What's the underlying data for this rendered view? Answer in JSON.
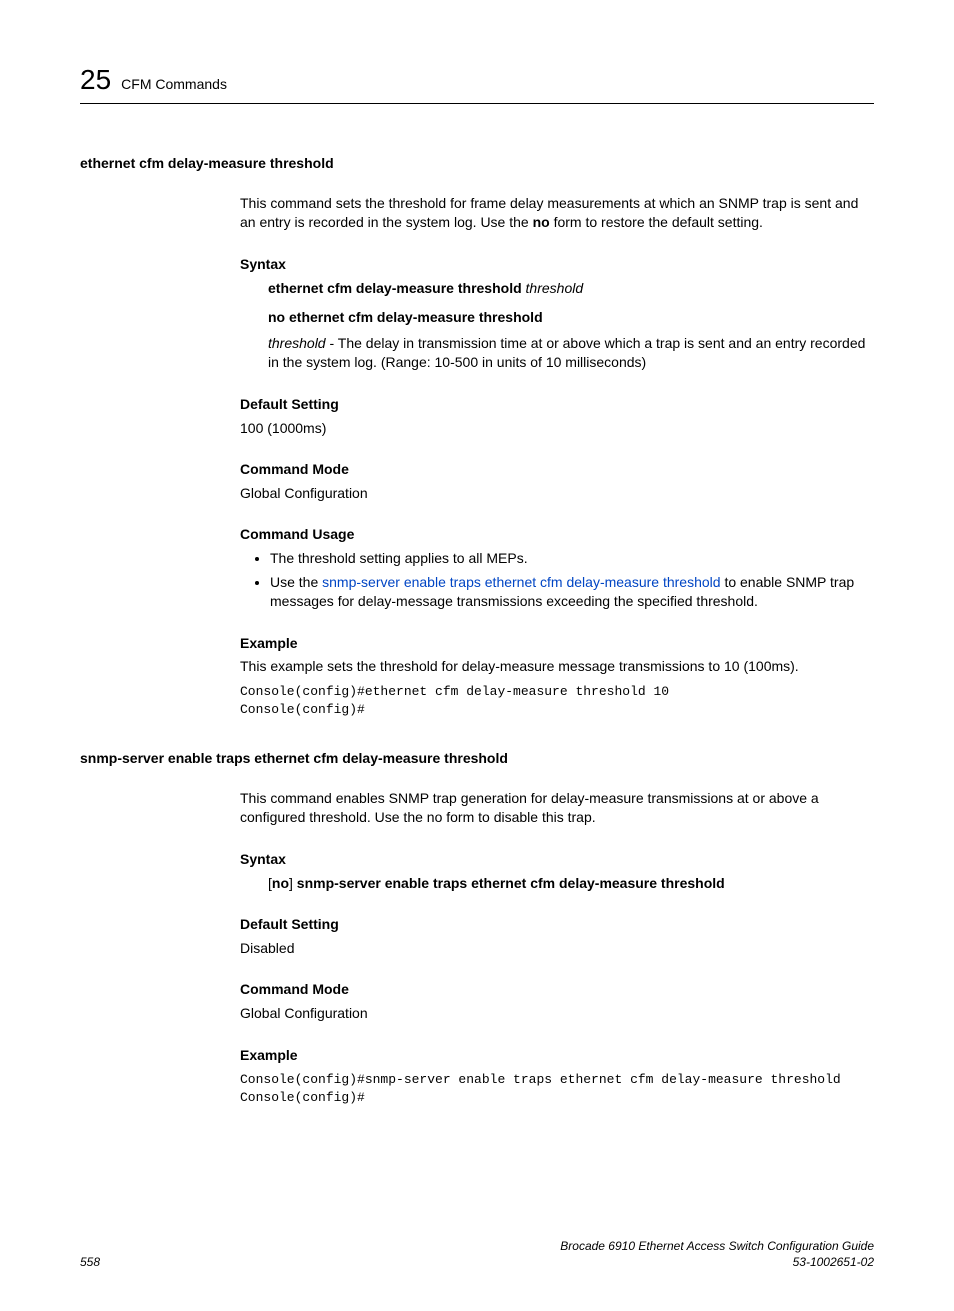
{
  "header": {
    "chapter_num": "25",
    "chapter_title": "CFM Commands"
  },
  "cmd1": {
    "heading": "ethernet cfm delay-measure threshold",
    "desc_pre": "This command sets the threshold for frame delay measurements at which an SNMP trap is sent and an entry is recorded in the system log. Use the ",
    "desc_bold": "no",
    "desc_post": " form to restore the default setting.",
    "syntax_label": "Syntax",
    "syntax_line1_bold": "ethernet cfm delay-measure threshold",
    "syntax_line1_italic": " threshold",
    "syntax_line2": "no ethernet cfm delay-measure threshold",
    "param_name": "threshold",
    "param_desc": " - The delay in transmission time at or above which a trap is sent and an entry recorded in the system log. (Range: 10-500 in units of 10 milliseconds)",
    "default_label": "Default Setting",
    "default_value": "100 (1000ms)",
    "mode_label": "Command Mode",
    "mode_value": "Global Configuration",
    "usage_label": "Command Usage",
    "usage_b1": "The threshold setting applies to all MEPs.",
    "usage_b2_pre": "Use the ",
    "usage_b2_link": "snmp-server enable traps ethernet cfm delay-measure threshold",
    "usage_b2_post": " to enable SNMP trap messages for delay-message transmissions exceeding the specified threshold.",
    "example_label": "Example",
    "example_desc": "This example sets the threshold for delay-measure message transmissions to 10 (100ms).",
    "example_code": "Console(config)#ethernet cfm delay-measure threshold 10\nConsole(config)#"
  },
  "cmd2": {
    "heading": "snmp-server enable traps ethernet cfm delay-measure threshold",
    "desc": "This command enables SNMP trap generation for delay-measure transmissions at or above a configured threshold. Use the no form to disable this trap.",
    "syntax_label": "Syntax",
    "syntax_pre": "[",
    "syntax_no": "no",
    "syntax_mid": "] ",
    "syntax_cmd": "snmp-server enable traps ethernet cfm delay-measure threshold",
    "default_label": "Default Setting",
    "default_value": "Disabled",
    "mode_label": "Command Mode",
    "mode_value": "Global Configuration",
    "example_label": "Example",
    "example_code": "Console(config)#snmp-server enable traps ethernet cfm delay-measure threshold\nConsole(config)#"
  },
  "footer": {
    "page_num": "558",
    "doc_title": "Brocade 6910 Ethernet Access Switch Configuration Guide",
    "doc_id": "53-1002651-02"
  }
}
